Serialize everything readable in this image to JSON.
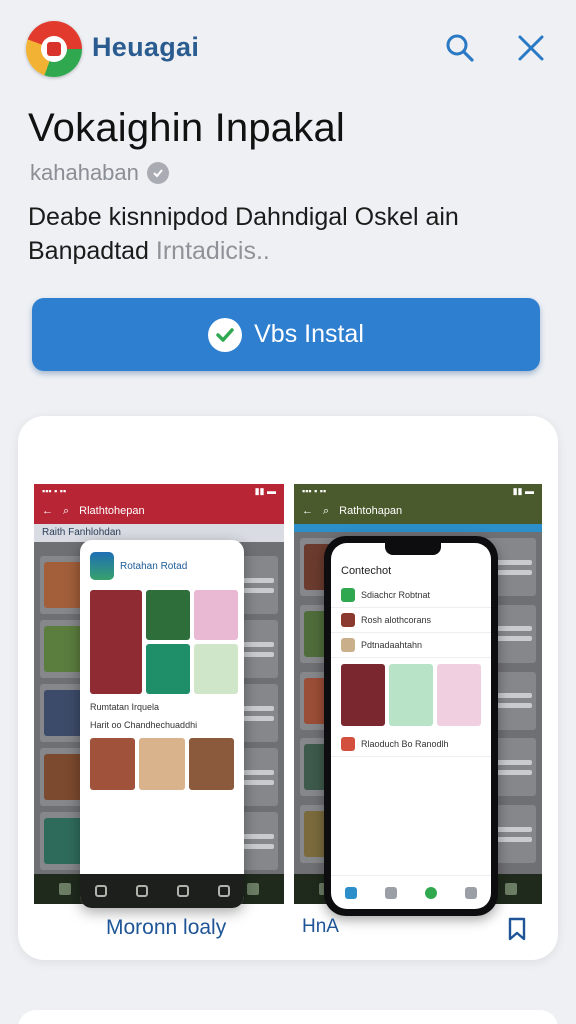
{
  "header": {
    "brand": "Hеuagai",
    "icons": {
      "logo": "app-logo",
      "search": "search-icon",
      "close": "close-icon"
    }
  },
  "app": {
    "title": "Vokaighin Inpakal",
    "publisher": "kahahaban",
    "description_line1": "Deabe kisnnipdod Dahndigal Oskel ain",
    "description_line2_a": "Banpadtad ",
    "description_line2_b": "Irntadicis.."
  },
  "install": {
    "label": "Vbs Instal",
    "icon": "install-check-icon"
  },
  "screens": {
    "left": {
      "top_title": "Rlathtohepan",
      "sub_title": "Raith Fanhlohdan",
      "popup_title": "Rotahan Rotad",
      "popup_line1": "Rumtatan Irquela",
      "popup_line2": "Harit oo Chandhechuaddhi"
    },
    "right": {
      "top_title": "Rathtohapan",
      "phone_title": "Contechot",
      "phone_item1": "Sdiachcr Robtnat",
      "phone_item2": "Rosh alothcorans",
      "phone_item3": "Pdtnadaahtahn",
      "phone_item4": "Rlaoduch Bo Ranodlh"
    }
  },
  "card_footer": {
    "more_label": "Moronn loaly",
    "tag_label": "HnA",
    "bookmark_icon": "bookmark-icon"
  },
  "colors": {
    "accent": "#2f7fd0",
    "brand": "#2a5c8f",
    "link": "#1f5597"
  }
}
